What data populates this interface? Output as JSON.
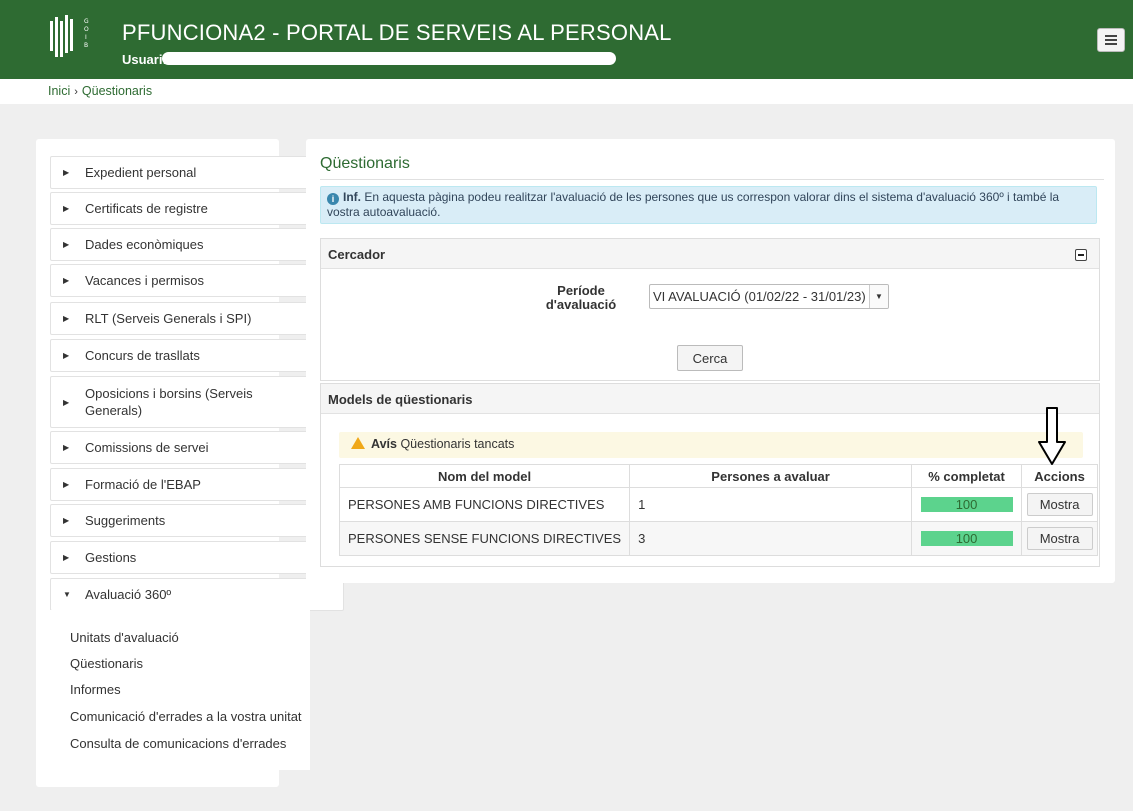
{
  "header": {
    "title": "PFUNCIONA2 - PORTAL DE SERVEIS AL PERSONAL",
    "user_label": "Usuari:",
    "logo_text": "GOIB"
  },
  "breadcrumb": {
    "home": "Inici",
    "separator": "›",
    "current": "Qüestionaris"
  },
  "sidebar": {
    "items": [
      {
        "label": "Expedient personal"
      },
      {
        "label": "Certificats de registre"
      },
      {
        "label": "Dades econòmiques"
      },
      {
        "label": "Vacances i permisos"
      },
      {
        "label": "RLT (Serveis Generals i SPI)"
      },
      {
        "label": "Concurs de trasllats"
      },
      {
        "label": "Oposicions i borsins (Serveis Generals)"
      },
      {
        "label": "Comissions de servei"
      },
      {
        "label": "Formació de l'EBAP"
      },
      {
        "label": "Suggeriments"
      },
      {
        "label": "Gestions"
      },
      {
        "label": "Avaluació 360º"
      }
    ],
    "submenu": [
      "Unitats d'avaluació",
      "Qüestionaris",
      "Informes",
      "Comunicació d'errades a la vostra unitat",
      "Consulta de comunicacions d'errades"
    ]
  },
  "main": {
    "title": "Qüestionaris",
    "info_prefix": "Inf.",
    "info_text": "En aquesta pàgina podeu realitzar l'avaluació de les persones que us correspon valorar dins el sistema d'avaluació 360º i també la vostra autoavaluació.",
    "search_panel": {
      "title": "Cercador",
      "period_label_line1": "Període",
      "period_label_line2": "d'avaluació",
      "period_value": "VI AVALUACIÓ (01/02/22 - 31/01/23)",
      "search_button": "Cerca"
    },
    "models_panel": {
      "title": "Models de qüestionaris",
      "warning_prefix": "Avís",
      "warning_text": "Qüestionaris tancats",
      "columns": [
        "Nom del model",
        "Persones a avaluar",
        "% completat",
        "Accions"
      ],
      "rows": [
        {
          "name": "PERSONES AMB FUNCIONS DIRECTIVES",
          "persons": "1",
          "completed": "100",
          "action": "Mostra"
        },
        {
          "name": "PERSONES SENSE FUNCIONS DIRECTIVES",
          "persons": "3",
          "completed": "100",
          "action": "Mostra"
        }
      ]
    }
  },
  "colors": {
    "header_green": "#2e6b32",
    "progress_green": "#5cd38d",
    "info_blue": "#d9edf7",
    "warning_yellow": "#fcf8e3"
  },
  "icons": [
    "menu-icon",
    "info-icon",
    "warning-icon",
    "down-arrow-icon",
    "collapse-icon"
  ]
}
